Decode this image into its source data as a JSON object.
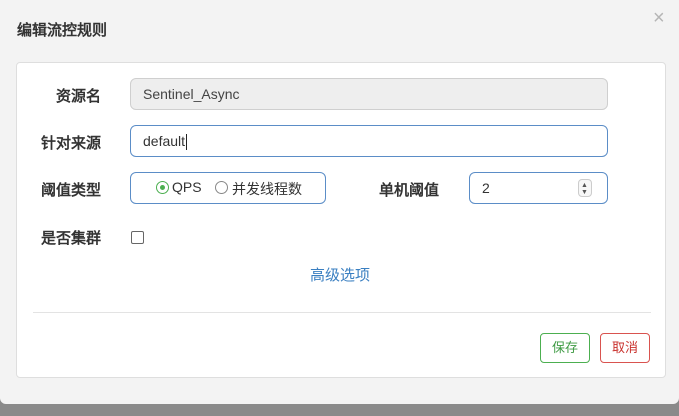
{
  "dialog": {
    "title": "编辑流控规则",
    "close_label": "×"
  },
  "form": {
    "resource": {
      "label": "资源名",
      "value": "Sentinel_Async"
    },
    "limit_app": {
      "label": "针对来源",
      "value": "default"
    },
    "grade": {
      "label": "阈值类型",
      "options": [
        {
          "label": "QPS",
          "selected": true
        },
        {
          "label": "并发线程数",
          "selected": false
        }
      ]
    },
    "count": {
      "label": "单机阈值",
      "value": "2"
    },
    "cluster": {
      "label": "是否集群",
      "checked": false
    },
    "advanced_link": "高级选项"
  },
  "footer": {
    "save_label": "保存",
    "cancel_label": "取消"
  },
  "colors": {
    "accent": "#5b8dc7",
    "save": "#4caf50",
    "cancel": "#d9534f",
    "link": "#3a7fc1"
  }
}
